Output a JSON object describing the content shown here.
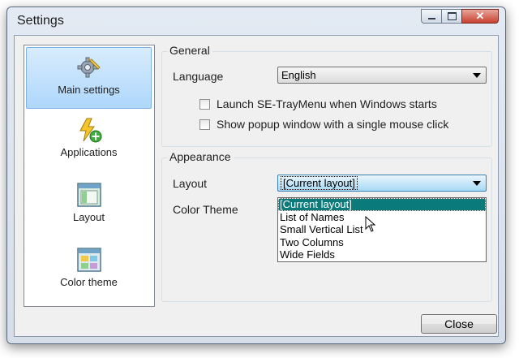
{
  "window": {
    "title": "Settings"
  },
  "sidebar": {
    "items": [
      {
        "label": "Main settings",
        "icon": "gear-icon",
        "selected": true
      },
      {
        "label": "Applications",
        "icon": "lightning-add-icon",
        "selected": false
      },
      {
        "label": "Layout",
        "icon": "layout-icon",
        "selected": false
      },
      {
        "label": "Color theme",
        "icon": "color-grid-icon",
        "selected": false
      }
    ]
  },
  "general": {
    "title": "General",
    "language_label": "Language",
    "language_value": "English",
    "launch_checkbox_label": "Launch SE-TrayMenu when Windows starts",
    "launch_checked": false,
    "popup_checkbox_label": "Show popup window with a single mouse click",
    "popup_checked": false
  },
  "appearance": {
    "title": "Appearance",
    "layout_label": "Layout",
    "layout_value": "[Current layout]",
    "color_theme_label": "Color Theme",
    "layout_options": [
      "[Current layout]",
      "List of Names",
      "Small Vertical List",
      "Two Columns",
      "Wide Fields"
    ],
    "highlighted_option": "[Current layout]"
  },
  "buttons": {
    "close_label": "Close"
  },
  "colors": {
    "selection_highlight": "#0a7a7a",
    "sidebar_selected": "#aed7fb",
    "close_button_red": "#c7412f"
  }
}
